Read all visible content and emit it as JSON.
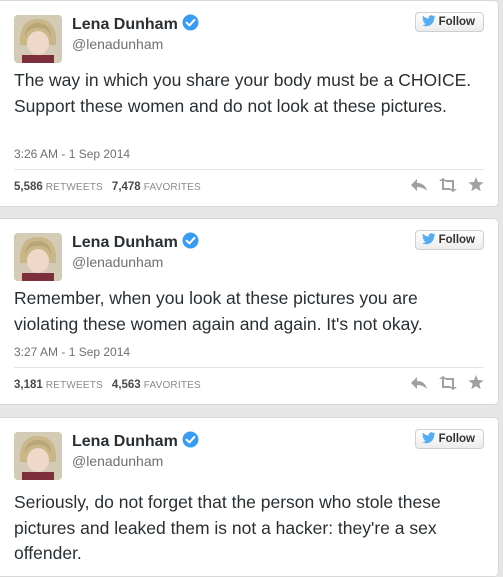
{
  "tweets": [
    {
      "name": "Lena Dunham",
      "handle": "@lenadunham",
      "follow_label": "Follow",
      "text": "The way in which you share your body must be a CHOICE. Support these women and do not look at these pictures.",
      "timestamp": "3:26 AM - 1 Sep 2014",
      "retweets": "5,586",
      "retweets_label": "RETWEETS",
      "favorites": "7,478",
      "favorites_label": "FAVORITES"
    },
    {
      "name": "Lena Dunham",
      "handle": "@lenadunham",
      "follow_label": "Follow",
      "text": "Remember, when you look at these pictures you are violating these women again and again. It's not okay.",
      "timestamp": "3:27 AM - 1 Sep 2014",
      "retweets": "3,181",
      "retweets_label": "RETWEETS",
      "favorites": "4,563",
      "favorites_label": "FAVORITES"
    },
    {
      "name": "Lena Dunham",
      "handle": "@lenadunham",
      "follow_label": "Follow",
      "text": "Seriously, do not forget that the person who stole these pictures and leaked them is not a hacker: they're a sex offender."
    }
  ],
  "icons": {
    "verified": "verified-badge-icon",
    "bird": "twitter-bird-icon",
    "reply": "reply-icon",
    "retweet": "retweet-icon",
    "favorite": "star-icon"
  },
  "colors": {
    "twitter_blue": "#55acee",
    "verified_blue": "#3a9cf0",
    "text": "#292f33",
    "secondary_text": "#707070",
    "action_icon": "#a0a0a0"
  }
}
